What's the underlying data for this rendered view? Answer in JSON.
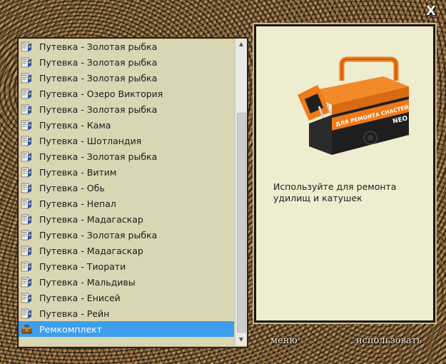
{
  "window": {
    "close_glyph": "X"
  },
  "items": [
    {
      "label": "Путевка - Золотая рыбка",
      "icon": "voucher-icon"
    },
    {
      "label": "Путевка - Золотая рыбка",
      "icon": "voucher-icon"
    },
    {
      "label": "Путевка - Золотая рыбка",
      "icon": "voucher-icon"
    },
    {
      "label": "Путевка - Озеро Виктория",
      "icon": "voucher-icon"
    },
    {
      "label": "Путевка - Золотая рыбка",
      "icon": "voucher-icon"
    },
    {
      "label": "Путевка - Кама",
      "icon": "voucher-icon"
    },
    {
      "label": "Путевка - Шотландия",
      "icon": "voucher-icon"
    },
    {
      "label": "Путевка - Золотая рыбка",
      "icon": "voucher-icon"
    },
    {
      "label": "Путевка - Витим",
      "icon": "voucher-icon"
    },
    {
      "label": "Путевка - Обь",
      "icon": "voucher-icon"
    },
    {
      "label": "Путевка - Непал",
      "icon": "voucher-icon"
    },
    {
      "label": "Путевка - Мадагаскар",
      "icon": "voucher-icon"
    },
    {
      "label": "Путевка - Золотая рыбка",
      "icon": "voucher-icon"
    },
    {
      "label": "Путевка - Мадагаскар",
      "icon": "voucher-icon"
    },
    {
      "label": "Путевка - Тиорати",
      "icon": "voucher-icon"
    },
    {
      "label": "Путевка - Мальдивы",
      "icon": "voucher-icon"
    },
    {
      "label": "Путевка - Енисей",
      "icon": "voucher-icon"
    },
    {
      "label": "Путевка - Рейн",
      "icon": "voucher-icon"
    },
    {
      "label": "Ремкомплект",
      "icon": "repair-kit-icon",
      "selected": true
    }
  ],
  "detail": {
    "image": "repair-toolbox-image",
    "image_lettering": "ДЛЯ РЕМОНТА СНАСТЕЙ",
    "image_brand": "NEO",
    "description": "Используйте для ремонта удилищ и катушек"
  },
  "buttons": {
    "menu": "меню",
    "use": "использовать"
  },
  "colors": {
    "list_background": "#d8d6b3",
    "selection": "#3d9eed",
    "detail_background": "#efedcf",
    "toolbox_orange": "#f07a18"
  }
}
